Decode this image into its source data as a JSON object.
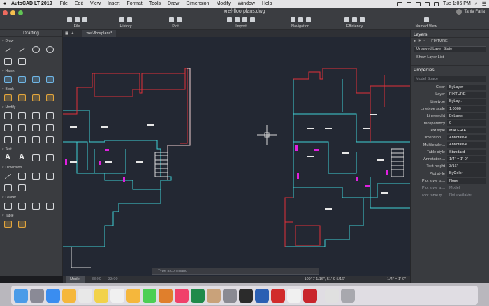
{
  "menubar": {
    "app_name": "AutoCAD LT 2019",
    "items": [
      "File",
      "Edit",
      "View",
      "Insert",
      "Format",
      "Tools",
      "Draw",
      "Dimension",
      "Modify",
      "Window",
      "Help"
    ],
    "time": "Tue 1:06 PM"
  },
  "titlebar": {
    "document": "xref-floorplans.dwg",
    "user": "Tania Farla"
  },
  "ribbon": [
    {
      "label": "File"
    },
    {
      "label": "History"
    },
    {
      "label": "Plot"
    },
    {
      "label": "Import"
    },
    {
      "label": "Navigation"
    },
    {
      "label": "Efficiency"
    },
    {
      "label": "Named View"
    }
  ],
  "left_panel": {
    "title": "Drafting",
    "sections": [
      {
        "name": "Draw",
        "tools": [
          "line-icon",
          "polyline-icon",
          "circle-icon",
          "arc-icon",
          "rectangle-icon",
          "polygon-icon"
        ]
      },
      {
        "name": "Hatch",
        "tools": [
          "hatch-icon",
          "hatch-solid-icon",
          "gradient-icon",
          "boundary-icon"
        ]
      },
      {
        "name": "Block",
        "tools": [
          "insert-block-icon",
          "create-block-icon",
          "edit-block-icon",
          "write-block-icon"
        ]
      },
      {
        "name": "Modify",
        "tools": [
          "move-icon",
          "copy-icon",
          "stretch-icon",
          "rotate-icon",
          "mirror-icon",
          "scale-icon",
          "trim-icon",
          "extend-icon",
          "offset-icon",
          "fillet-icon",
          "array-icon",
          "erase-icon"
        ]
      },
      {
        "name": "Text",
        "tools": [
          "mtext-icon",
          "text-icon",
          "edit-text-icon",
          "find-text-icon"
        ]
      },
      {
        "name": "Dimension",
        "tools": [
          "linear-dim-icon",
          "aligned-dim-icon",
          "angular-dim-icon",
          "radius-dim-icon",
          "diameter-dim-icon",
          "baseline-icon"
        ]
      },
      {
        "name": "Leader",
        "tools": [
          "multileader-icon",
          "add-leader-icon",
          "remove-leader-icon",
          "align-leader-icon"
        ]
      },
      {
        "name": "Table",
        "tools": [
          "table-icon",
          "table-style-icon"
        ]
      }
    ]
  },
  "doc_tab": "xref-floorplans*",
  "command_placeholder": "Type a command",
  "statusbar": {
    "model": "Model",
    "layout1": "33:00",
    "layout2": "33:00",
    "coords": "109'-7 1/16\", 51'-9 5/16\"",
    "scale": "1/4\" = 1'-0\""
  },
  "right_panel": {
    "layers_title": "Layers",
    "current_layer": "FIXTURE",
    "layer_state": "Unsaved Layer State",
    "show_layer_list": "Show Layer List",
    "properties_title": "Properties",
    "selection": "Model Space",
    "properties": [
      {
        "key": "Color",
        "value": "ByLayer"
      },
      {
        "key": "Layer",
        "value": "FIXTURE"
      },
      {
        "key": "Linetype",
        "value": "ByLay..."
      },
      {
        "key": "Linetype scale",
        "value": "1.0000"
      },
      {
        "key": "Lineweight",
        "value": "ByLayer"
      },
      {
        "key": "Transparency",
        "value": "0"
      },
      {
        "key": "Text style",
        "value": "MATERIA"
      },
      {
        "key": "Dimension ...",
        "value": "Annotative"
      },
      {
        "key": "Multileader...",
        "value": "Annotative"
      },
      {
        "key": "Table style",
        "value": "Standard"
      },
      {
        "key": "Annotation...",
        "value": "1/4\" = 1'-0\""
      },
      {
        "key": "Text height",
        "value": "3/16\""
      },
      {
        "key": "Plot style",
        "value": "ByColor"
      },
      {
        "key": "Plot style ta...",
        "value": "None"
      },
      {
        "key": "Plot style at...",
        "value": "Model"
      },
      {
        "key": "Plot table ty...",
        "value": "Not available"
      }
    ]
  },
  "dock": [
    "Finder",
    "Launchpad",
    "Safari",
    "Photos",
    "Calendar",
    "Notes",
    "Reminders",
    "Photos",
    "Messages",
    "Books",
    "Music",
    "Excel",
    "Contacts",
    "System Preferences",
    "Terminal",
    "Word",
    "Acrobat",
    "Chrome",
    "AutoCAD",
    "Preview",
    "Trash"
  ]
}
